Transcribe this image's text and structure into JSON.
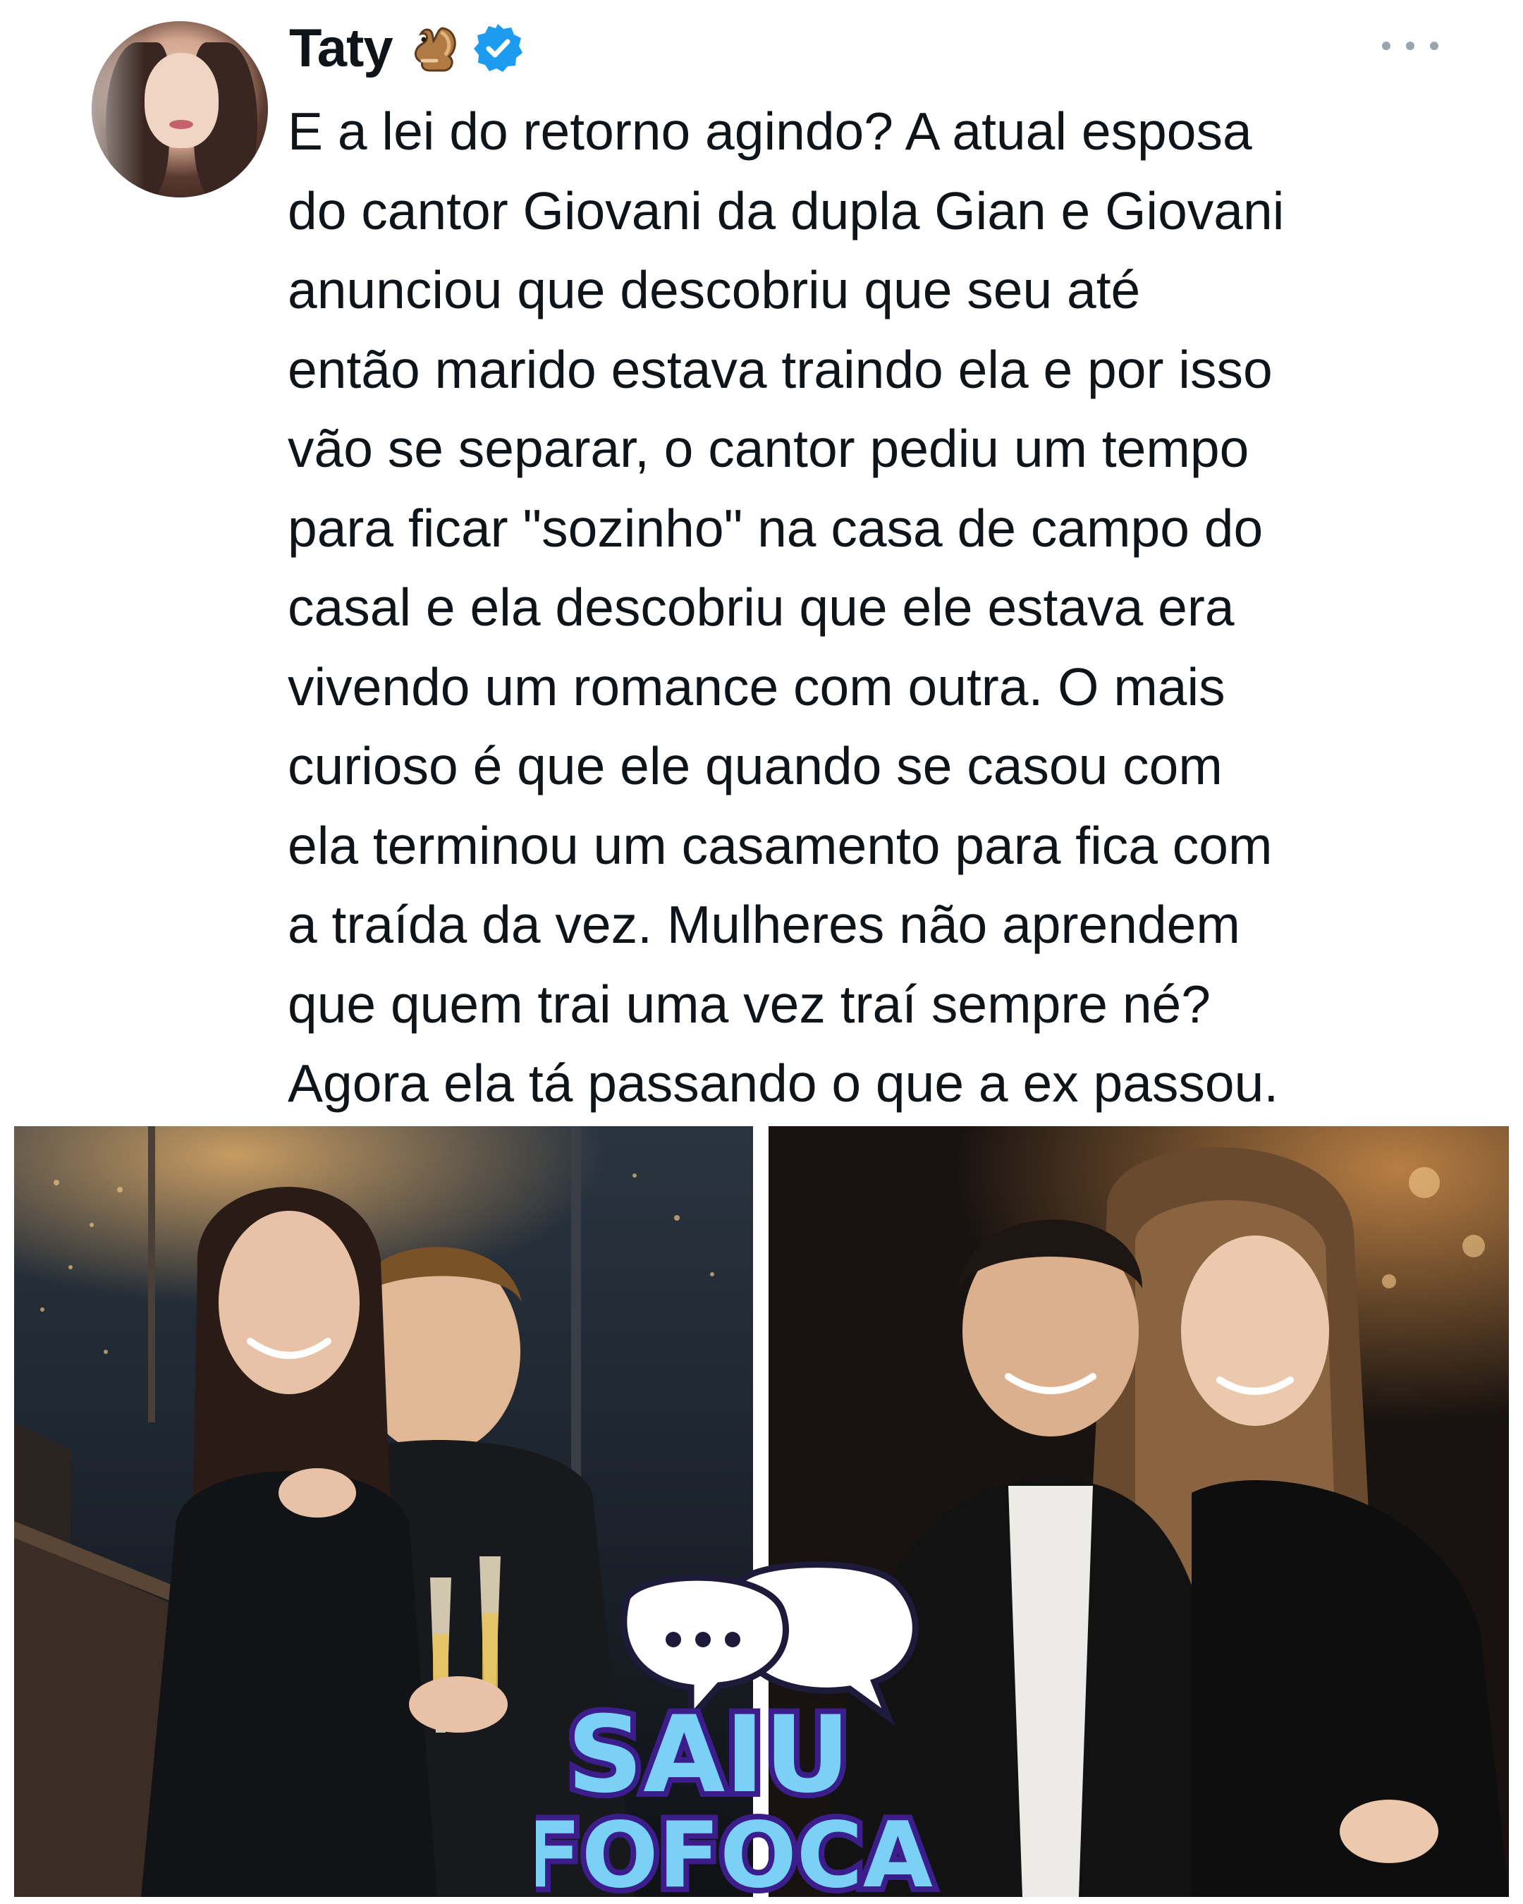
{
  "tweet": {
    "author_name": "Taty",
    "author_emoji": "🐿",
    "verified_icon": "verified-badge-icon",
    "more_icon": "more-options-icon",
    "text_lines": [
      "E a lei do retorno agindo? A atual esposa",
      "do cantor Giovani da dupla Gian e Giovani",
      "anunciou que descobriu que seu até",
      "então marido estava traindo ela e por isso",
      "vão se separar, o cantor pediu um tempo",
      "para ficar \"sozinho\" na casa de campo do",
      "casal e ela descobriu que ele estava era",
      "vivendo um romance com outra. O mais",
      "curioso é que ele quando se casou com",
      "ela terminou um casamento para fica com",
      "a traída da vez. Mulheres não aprendem",
      "que quem trai uma vez traí sempre né?",
      "Agora ela tá passando o que a ex passou."
    ]
  },
  "watermark": {
    "line1": "SAIU",
    "line2": "FOFOCA",
    "icon": "speech-bubbles-icon"
  },
  "colors": {
    "text": "#0f1419",
    "verified": "#1d9bf0",
    "watermark_fill": "#7ad0f5",
    "watermark_outline": "#3b1e8c"
  }
}
